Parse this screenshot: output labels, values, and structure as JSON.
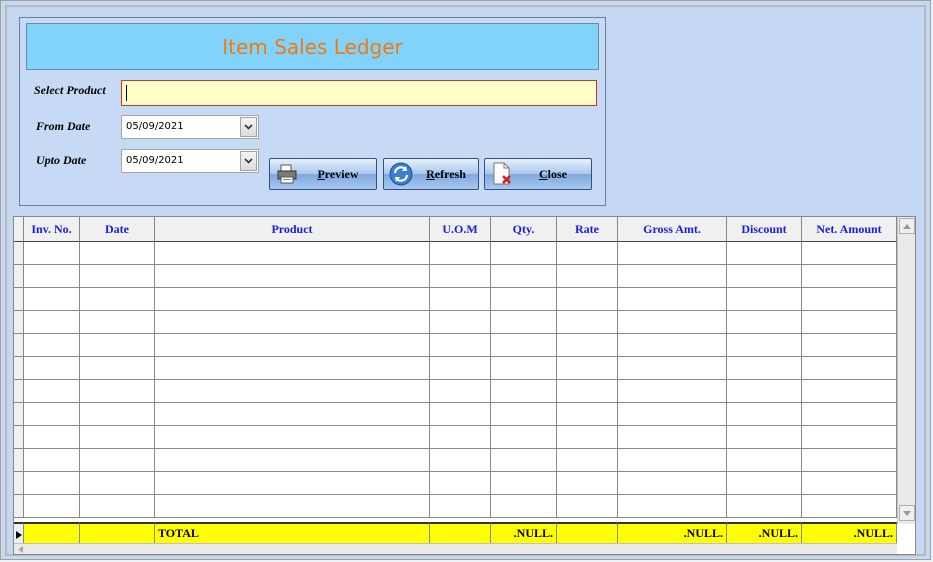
{
  "title": "Item Sales Ledger",
  "filters": {
    "product_label": "Select Product",
    "product_value": "",
    "from_label": "From Date",
    "from_value": "05/09/2021",
    "upto_label": "Upto Date",
    "upto_value": "05/09/2021"
  },
  "buttons": {
    "preview": "Preview",
    "refresh": "Refresh",
    "close": "Close"
  },
  "grid": {
    "columns": [
      "Inv. No.",
      "Date",
      "Product",
      "U.O.M",
      "Qty.",
      "Rate",
      "Gross Amt.",
      "Discount",
      "Net. Amount"
    ],
    "total": {
      "label": "TOTAL",
      "qty": ".NULL.",
      "gross": ".NULL.",
      "discount": ".NULL.",
      "net": ".NULL."
    }
  },
  "icons": {
    "preview": "printer-icon",
    "refresh": "refresh-icon",
    "close": "close-document-icon",
    "dropdown": "chevron-down-icon"
  }
}
